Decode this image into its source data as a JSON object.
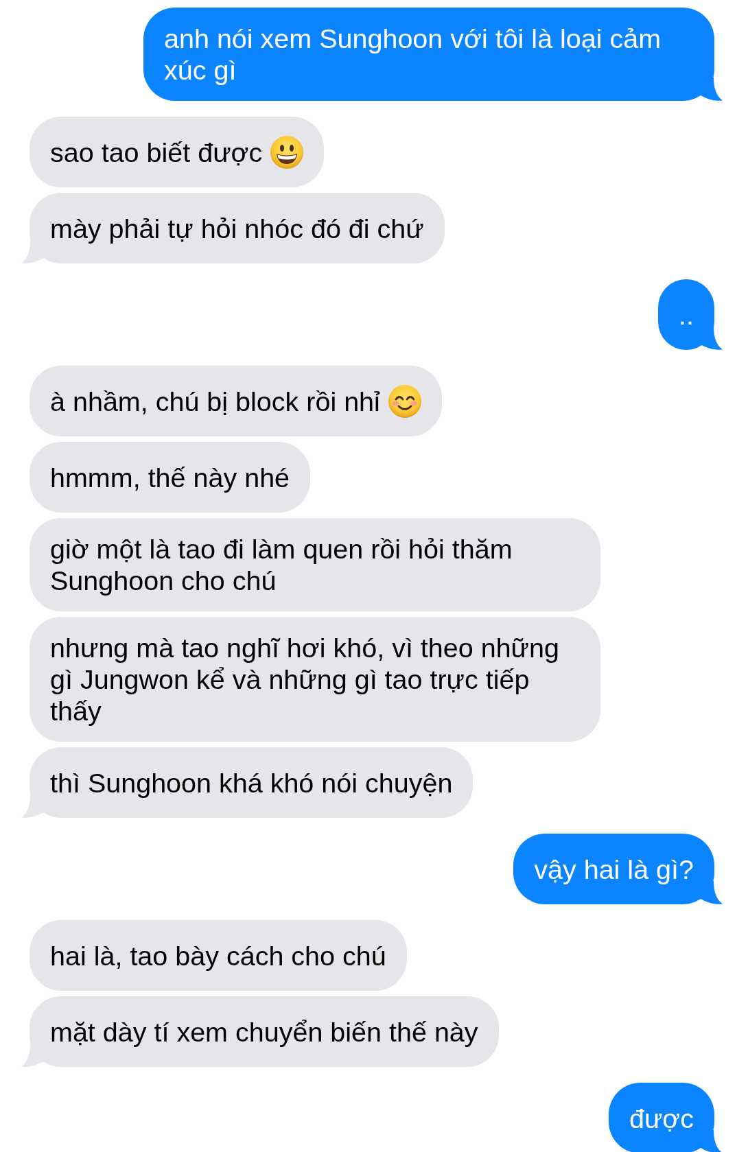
{
  "messages": [
    {
      "kind": "sent",
      "text": "anh nói xem Sunghoon với tôi là loại cảm xúc gì",
      "tail": true
    },
    {
      "kind": "received",
      "text": "sao tao biết được",
      "emoji": {
        "kind": "grinning"
      },
      "tail": false
    },
    {
      "kind": "received",
      "text": "mày phải tự hỏi nhóc đó đi chứ",
      "tail": true
    },
    {
      "kind": "sent",
      "text": "..",
      "tail": true
    },
    {
      "kind": "received",
      "text": "à nhầm, chú bị block rồi nhỉ",
      "emoji": {
        "kind": "smiling"
      },
      "tail": false
    },
    {
      "kind": "received",
      "text": "hmmm, thế này nhé",
      "tail": false
    },
    {
      "kind": "received",
      "text": "giờ một là tao đi làm quen rồi hỏi thăm Sunghoon cho chú",
      "tail": false
    },
    {
      "kind": "received",
      "text": "nhưng mà tao nghĩ hơi khó, vì theo những gì Jungwon kể và những gì tao trực tiếp thấy",
      "tail": false
    },
    {
      "kind": "received",
      "text": "thì Sunghoon khá khó nói chuyện",
      "tail": true
    },
    {
      "kind": "sent",
      "text": "vậy hai là gì?",
      "tail": true
    },
    {
      "kind": "received",
      "text": "hai là, tao bày cách cho chú",
      "tail": false
    },
    {
      "kind": "received",
      "text": "mặt dày tí xem chuyển biến thế này",
      "tail": true
    },
    {
      "kind": "sent",
      "text": "được",
      "tail": true
    }
  ]
}
